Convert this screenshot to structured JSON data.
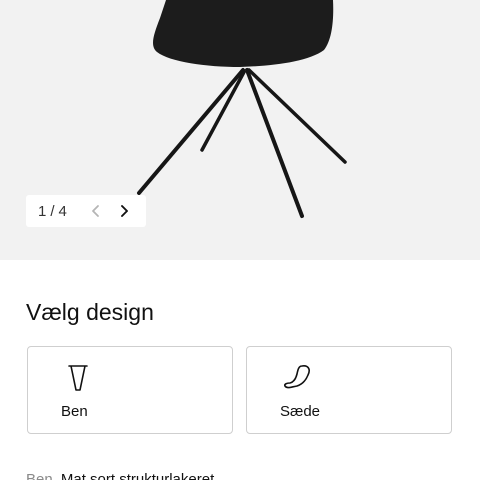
{
  "gallery": {
    "image": "black-chair-product-photo",
    "pager": {
      "current": "1",
      "separator": "/",
      "total": "4",
      "prev_icon": "chevron-left-icon",
      "next_icon": "chevron-right-icon"
    }
  },
  "design": {
    "title": "Vælg design",
    "options": [
      {
        "label": "Ben",
        "icon": "chair-leg-icon"
      },
      {
        "label": "Sæde",
        "icon": "chair-seat-icon"
      }
    ]
  },
  "spec": {
    "key": "Ben",
    "value": "Mat sort strukturlakeret"
  },
  "colors": {
    "background": "#ffffff",
    "gallery_background": "#f2f2f2",
    "card_border": "#cfcfcf",
    "muted_text": "#8a8a8a",
    "product": "#1c1c1c"
  }
}
